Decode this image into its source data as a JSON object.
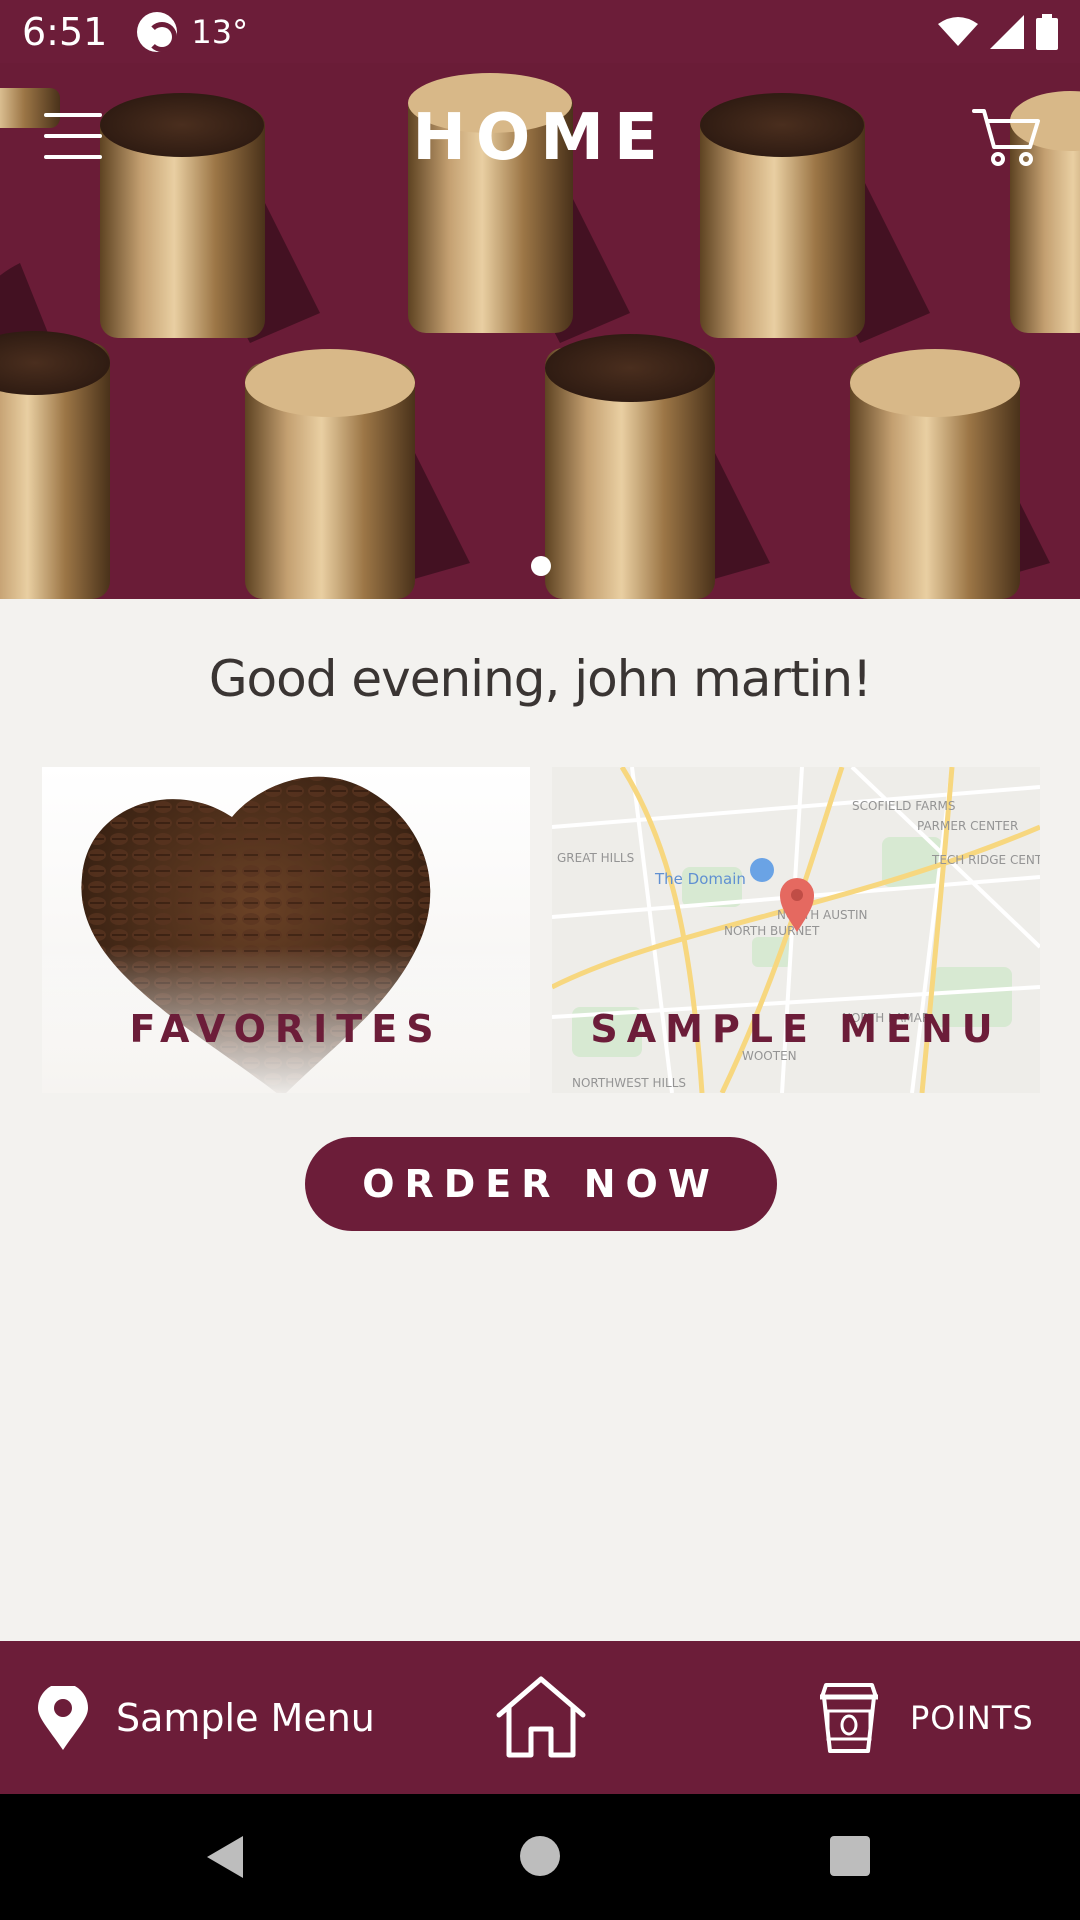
{
  "status_bar": {
    "time": "6:51",
    "temperature": "13°"
  },
  "header": {
    "title": "HOME"
  },
  "hero": {
    "pager_count": 1,
    "active_page": 1
  },
  "greeting": "Good evening, john martin!",
  "cards": {
    "favorites_label": "FAVORITES",
    "sample_menu_label": "SAMPLE MENU"
  },
  "map": {
    "labels": [
      "SCOFIELD FARMS",
      "PARMER CENTER",
      "GREAT HILLS",
      "The Domain",
      "TECH RIDGE CENTER",
      "NORTH AUSTIN",
      "NORTH BURNET",
      "NORTH LAMAR",
      "WOOTEN",
      "NORTHWEST HILLS"
    ]
  },
  "order_button": "ORDER NOW",
  "bottom_nav": {
    "location_label": "Sample Menu",
    "points_label": "POINTS"
  },
  "colors": {
    "brand": "#6c1d39",
    "background": "#f3f2ef"
  },
  "icons": [
    "menu-icon",
    "cart-icon",
    "location-pin-icon",
    "home-icon",
    "coffee-cup-icon"
  ]
}
